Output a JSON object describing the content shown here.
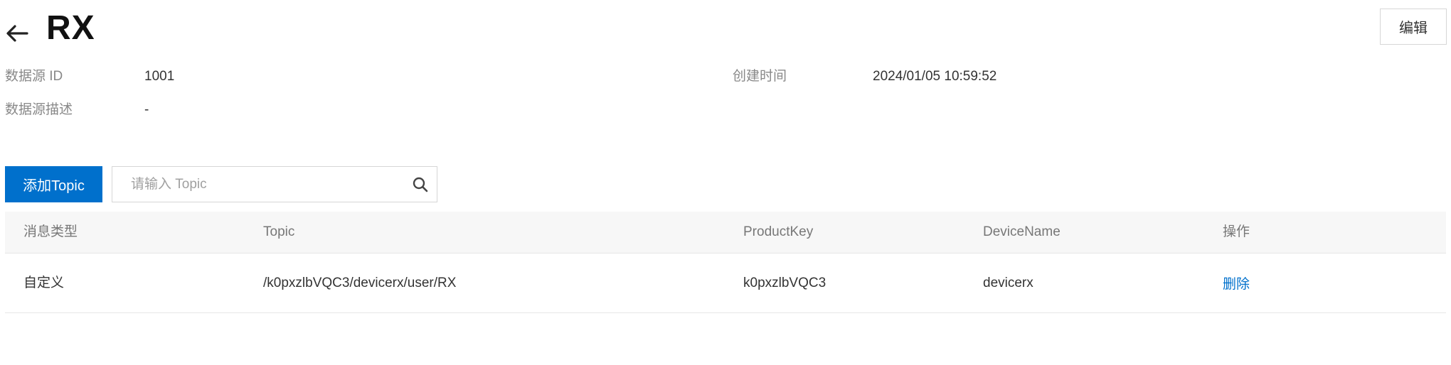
{
  "header": {
    "title": "RX",
    "edit_label": "编辑"
  },
  "info": {
    "id_label": "数据源 ID",
    "id_value": "1001",
    "created_label": "创建时间",
    "created_value": "2024/01/05 10:59:52",
    "desc_label": "数据源描述",
    "desc_value": "-"
  },
  "toolbar": {
    "add_label": "添加Topic",
    "search_placeholder": "请输入 Topic"
  },
  "table": {
    "columns": [
      "消息类型",
      "Topic",
      "ProductKey",
      "DeviceName",
      "操作"
    ],
    "rows": [
      {
        "type": "自定义",
        "topic": "/k0pxzlbVQC3/devicerx/user/RX",
        "product_key": "k0pxzlbVQC3",
        "device_name": "devicerx",
        "action": "删除"
      }
    ]
  },
  "colors": {
    "primary": "#0070cc",
    "header_bg": "#f7f7f7",
    "border": "#e6e6e6"
  },
  "icons": [
    "arrow-left-icon",
    "search-icon"
  ]
}
